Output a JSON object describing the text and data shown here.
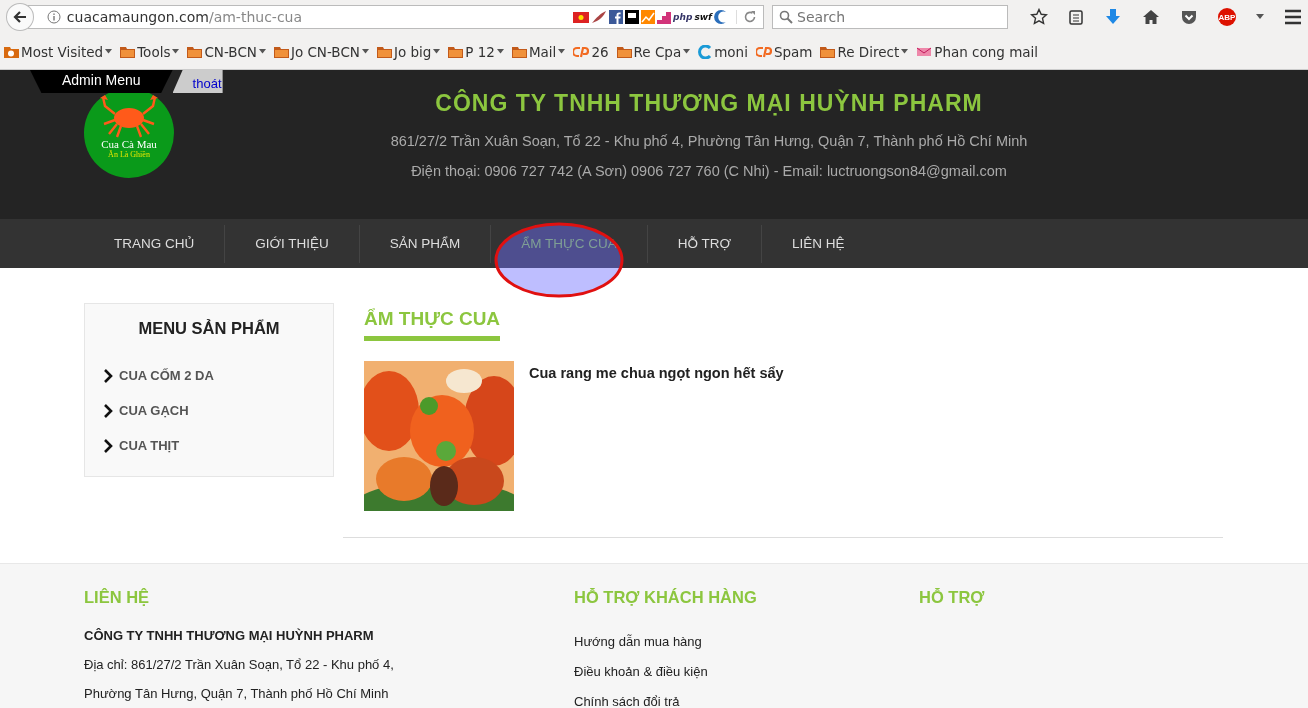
{
  "browser": {
    "url_host": "cuacamaungon.com",
    "url_path": "/am-thuc-cua",
    "search_placeholder": "Search",
    "extension_labels": [
      "php",
      "swf"
    ],
    "adblock_label": "ABP",
    "bookmarks": [
      {
        "label": "Most Visited",
        "kind": "special",
        "dropdown": true
      },
      {
        "label": "Tools",
        "kind": "folder",
        "dropdown": true
      },
      {
        "label": "CN-BCN",
        "kind": "folder",
        "dropdown": true
      },
      {
        "label": "Jo CN-BCN",
        "kind": "folder",
        "dropdown": true
      },
      {
        "label": "Jo big",
        "kind": "folder",
        "dropdown": true
      },
      {
        "label": "P 12",
        "kind": "folder",
        "dropdown": true
      },
      {
        "label": "Mail",
        "kind": "folder",
        "dropdown": true
      },
      {
        "label": "26",
        "kind": "cpanel",
        "dropdown": false
      },
      {
        "label": "Re Cpa",
        "kind": "folder",
        "dropdown": true
      },
      {
        "label": "moni",
        "kind": "c",
        "dropdown": false
      },
      {
        "label": "Spam",
        "kind": "cpanel",
        "dropdown": false
      },
      {
        "label": "Re Direct",
        "kind": "folder",
        "dropdown": true
      },
      {
        "label": "Phan cong mail",
        "kind": "mail",
        "dropdown": false
      }
    ]
  },
  "admin_bar": {
    "title": "Admin Menu",
    "logout": "thoát"
  },
  "logo": {
    "name": "Cua Cà Mau",
    "slogan": "Ăn Là Ghiền"
  },
  "header": {
    "company": "CÔNG TY TNHH THƯƠNG MẠI HUỲNH PHARM",
    "address": "861/27/2 Trần Xuân Soạn, Tổ 22 - Khu phố 4, Phường Tân Hưng, Quận 7, Thành phố Hồ Chí Minh",
    "contact": "Điện thoại: 0906 727 742 (A Sơn) 0906 727 760 (C Nhi) - Email: luctruongson84@gmail.com"
  },
  "nav": [
    {
      "label": "TRANG CHỦ",
      "selected": false
    },
    {
      "label": "GIỚI THIỆU",
      "selected": false
    },
    {
      "label": "SẢN PHẨM",
      "selected": false
    },
    {
      "label": "ẨM THỰC CUA",
      "selected": true
    },
    {
      "label": "HỖ TRỢ",
      "selected": false
    },
    {
      "label": "LIÊN HỆ",
      "selected": false
    }
  ],
  "sidebar": {
    "title": "MENU SẢN PHẨM",
    "items": [
      "CUA CỐM 2 DA",
      "CUA GẠCH",
      "CUA THỊT"
    ]
  },
  "main": {
    "title": "ẨM THỰC CUA",
    "posts": [
      {
        "title": "Cua rang me chua ngọt ngon hết sẩy"
      }
    ]
  },
  "footer": {
    "columns": [
      {
        "title": "LIÊN HỆ",
        "kind": "contact",
        "lines": [
          "CÔNG TY TNHH THƯƠNG MẠI HUỲNH PHARM",
          "Địa chỉ: 861/27/2 Trần Xuân Soạn, Tổ 22 - Khu phố 4,",
          "Phường Tân Hưng, Quận 7, Thành phố Hồ Chí Minh"
        ]
      },
      {
        "title": "HỖ TRỢ KHÁCH HÀNG",
        "kind": "links",
        "lines": [
          "Hướng dẫn mua hàng",
          "Điều khoản & điều kiện",
          "Chính sách đổi trả"
        ]
      },
      {
        "title": "HỖ TRỢ",
        "kind": "links"
      }
    ]
  }
}
